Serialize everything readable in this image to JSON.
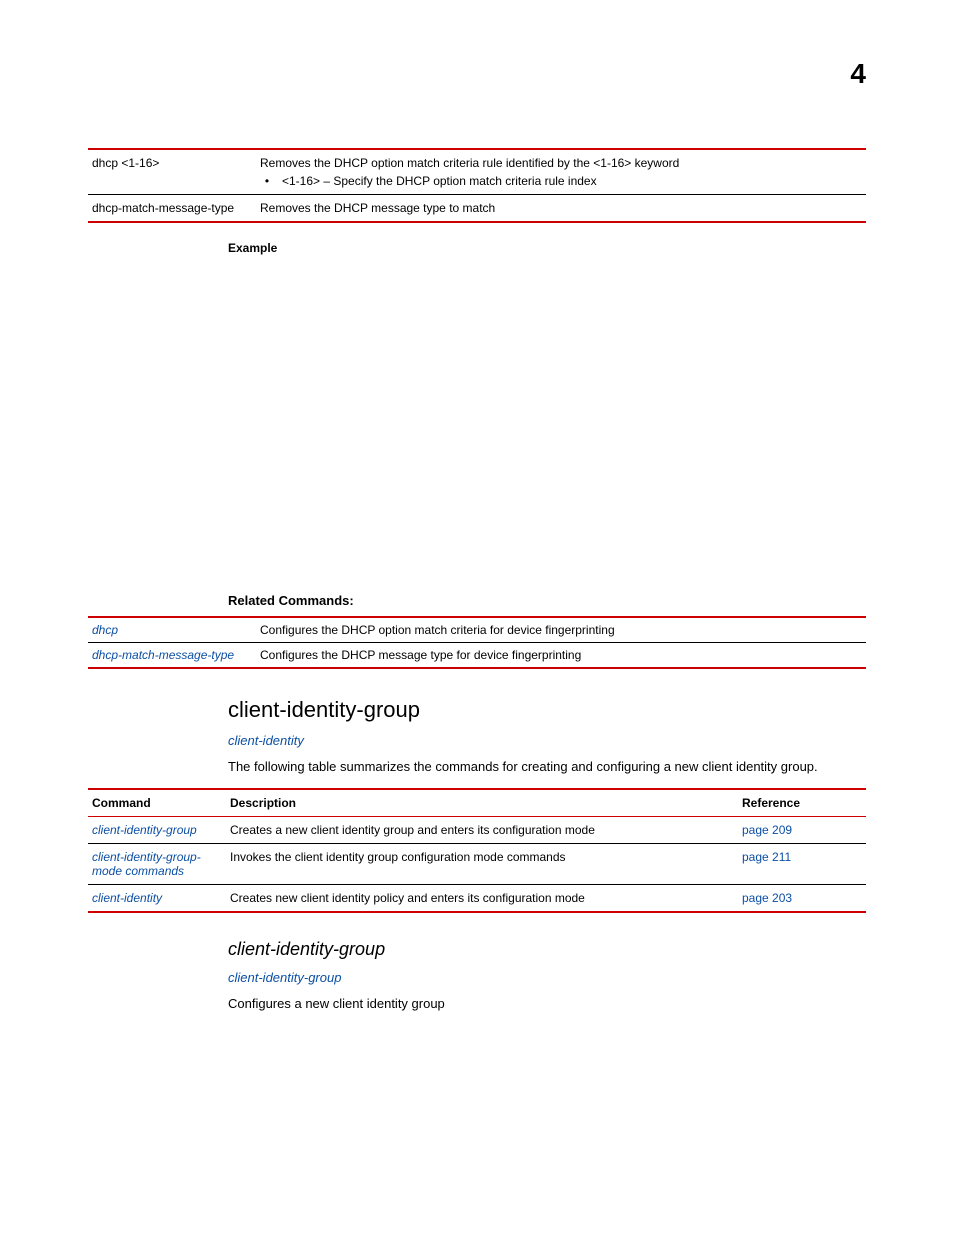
{
  "chapter_number": "4",
  "table1": {
    "rows": [
      {
        "param": "dhcp <1-16>",
        "desc": "Removes the DHCP option match criteria rule identified by the <1-16> keyword",
        "bullet": "<1-16> – Specify the DHCP option match criteria rule index"
      },
      {
        "param": "dhcp-match-message-type",
        "desc": "Removes the DHCP message type to match"
      }
    ]
  },
  "labels": {
    "example": "Example",
    "related": "Related Commands:"
  },
  "related_table": {
    "rows": [
      {
        "cmd": "dhcp",
        "desc": "Configures the DHCP option match criteria for device fingerprinting"
      },
      {
        "cmd": "dhcp-match-message-type",
        "desc": "Configures the DHCP message type for device fingerprinting"
      }
    ]
  },
  "section1": {
    "title": "client-identity-group",
    "sub_link": "client-identity",
    "paragraph": "The following table summarizes the commands for creating and configuring a new client identity group."
  },
  "cmd_table": {
    "headers": {
      "c1": "Command",
      "c2": "Description",
      "c3": "Reference"
    },
    "rows": [
      {
        "cmd": "client-identity-group",
        "desc": "Creates a new client identity group and enters its configuration mode",
        "ref": "page 209"
      },
      {
        "cmd": "client-identity-group-mode commands",
        "desc": "Invokes the client identity group configuration mode commands",
        "ref": "page 211"
      },
      {
        "cmd": "client-identity",
        "desc": "Creates new client identity policy and enters its configuration mode",
        "ref": "page 203"
      }
    ]
  },
  "section2": {
    "title": "client-identity-group",
    "sub_link": "client-identity-group",
    "paragraph": "Configures a new client identity group"
  }
}
